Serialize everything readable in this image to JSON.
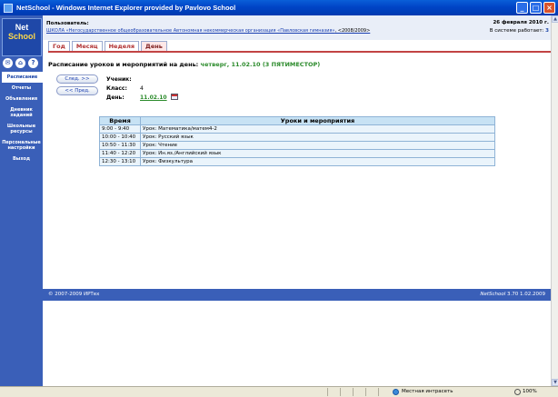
{
  "window": {
    "title": "NetSchool - Windows Internet Explorer provided by Pavlovo School",
    "minimize": "_",
    "maximize": "□",
    "close": "×"
  },
  "sidebar": {
    "logo_line1": "Net",
    "logo_line2": "School",
    "icons": [
      "mail-icon",
      "home-icon",
      "help-icon"
    ],
    "icon_glyphs": [
      "✉",
      "⌂",
      "?"
    ],
    "items": [
      {
        "label": "Расписание",
        "active": true
      },
      {
        "label": "Отчеты",
        "active": false
      },
      {
        "label": "Объявления",
        "active": false
      },
      {
        "label": "Дневник заданий",
        "active": false
      },
      {
        "label": "Школьные ресурсы",
        "active": false
      },
      {
        "label": "Персональные настройки",
        "active": false
      },
      {
        "label": "Выход",
        "active": false
      }
    ]
  },
  "header": {
    "users_label": "Пользователь:",
    "school": "ШКОЛА «Негосударственное общеобразовательное Автономная некоммерческая организация «Павловская гимназия»",
    "school_year": ", <2008/2009>",
    "date": "26 февраля 2010 г.",
    "online_label": "В системе работает:",
    "online_count": "3"
  },
  "tabs": [
    {
      "label": "Год",
      "active": false
    },
    {
      "label": "Месяц",
      "active": false
    },
    {
      "label": "Неделя",
      "active": false
    },
    {
      "label": "День",
      "active": true
    }
  ],
  "main": {
    "heading": "Расписание уроков и мероприятий на день:",
    "day_info": "четверг, 11.02.10 (3 ПЯТИМЕСТОР)",
    "next_button": "След. >>",
    "prev_button": "<< Пред.",
    "student_label": "Ученик:",
    "student_value": "",
    "class_label": "Класс:",
    "class_value": "4",
    "day_label": "День:",
    "day_value": "11.02.10"
  },
  "schedule": {
    "headers": [
      "Время",
      "Уроки и мероприятия"
    ],
    "rows": [
      [
        "9:00 - 9:40",
        "Урок: Математика/матем4-2"
      ],
      [
        "10:00 - 10:40",
        "Урок: Русский язык"
      ],
      [
        "10:50 - 11:30",
        "Урок: Чтение"
      ],
      [
        "11:40 - 12:20",
        "Урок: Ин.яз./Английский язык"
      ],
      [
        "12:30 - 13:10",
        "Урок: Физкультура"
      ]
    ]
  },
  "footer": {
    "copyright": "© 2007-2009 ИРТех",
    "product": "NetSchool",
    "version": "3.70 1.02.2009"
  },
  "statusbar": {
    "zone": "Местная интрасеть",
    "zoom": "100%"
  }
}
